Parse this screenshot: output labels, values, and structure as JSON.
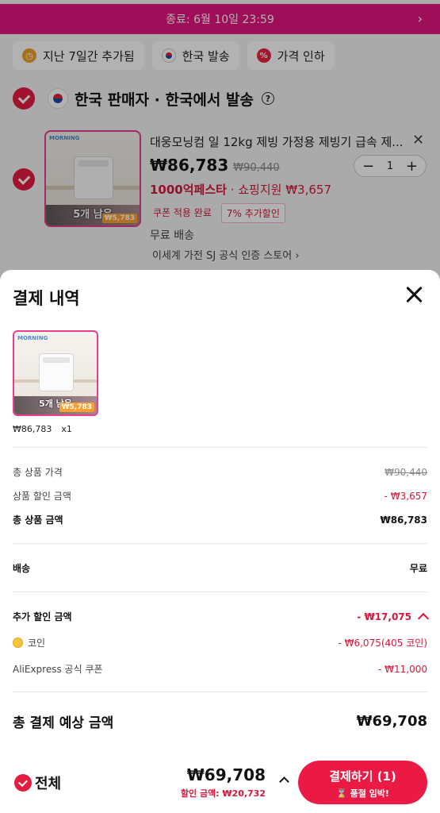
{
  "promo_bar": {
    "text": "종료: 6월 10일 23:59"
  },
  "chips": [
    {
      "label": "지난 7일간 추가됨",
      "icon": "clock-icon"
    },
    {
      "label": "한국 발송",
      "icon": "korea-flag-icon"
    },
    {
      "label": "가격 인하",
      "icon": "percent-icon"
    }
  ],
  "seller": {
    "title": "한국 판매자 · 한국에서 발송",
    "help": "?"
  },
  "product": {
    "title": "대웅모닝컴 일 12kg 제빙 가정용 제빙기 급속 제...",
    "price": "₩86,783",
    "original_price": "₩90,440",
    "quantity": "1",
    "stepper_minus": "−",
    "stepper_plus": "+",
    "promo_name": "1000억페스타",
    "promo_sub": " · 쇼핑지원 ₩3,657",
    "badge_coupon": "쿠폰 적용 완료",
    "badge_extra": "7% 추가할인",
    "shipping": "무료 배송",
    "store": "이세계 가전 SJ 공식 인증 스토어 ›",
    "thumb_stock": "5개 남음",
    "thumb_brand": "MORNING",
    "thumb_sale": "₩5,783"
  },
  "sheet": {
    "title": "결제 내역",
    "item_price": "₩86,783",
    "item_qty": "x1",
    "rows": {
      "total_product_price_label": "총 상품 가격",
      "total_product_price_value": "₩90,440",
      "discount_label": "상품 할인 금액",
      "discount_value": "- ₩3,657",
      "subtotal_label": "총 상품 금액",
      "subtotal_value": "₩86,783",
      "shipping_label": "배송",
      "shipping_value": "무료",
      "extra_discount_label": "추가 할인 금액",
      "extra_discount_value": "- ₩17,075",
      "coin_label": "코인",
      "coin_value": "- ₩6,075(405 코인)",
      "coupon_label": "AliExpress 공식 쿠폰",
      "coupon_value": "- ₩11,000"
    },
    "total_label": "총 결제 예상 금액",
    "total_value": "₩69,708"
  },
  "bottom_bar": {
    "select_all": "전체",
    "total": "₩69,708",
    "discount_text": "할인 금액: ₩20,732",
    "pay_label": "결제하기 (1)",
    "pay_sub": "⌛ 품절 임박!"
  },
  "colors": {
    "brand_pink": "#e4157f",
    "accent_red": "#ea1a45",
    "check_red": "#e51c42"
  }
}
